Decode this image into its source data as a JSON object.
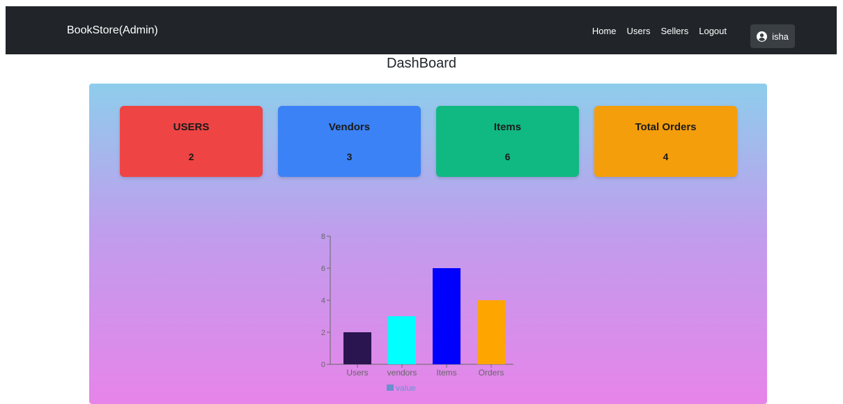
{
  "nav": {
    "brand": "BookStore(Admin)",
    "links": [
      "Home",
      "Users",
      "Sellers",
      "Logout"
    ],
    "user": {
      "name": "isha",
      "icon": "user-circle-icon"
    }
  },
  "page": {
    "title": "DashBoard"
  },
  "cards": [
    {
      "title": "USERS",
      "value": "2",
      "color": "#ef4444"
    },
    {
      "title": "Vendors",
      "value": "3",
      "color": "#3b82f6"
    },
    {
      "title": "Items",
      "value": "6",
      "color": "#10b981"
    },
    {
      "title": "Total Orders",
      "value": "4",
      "color": "#f59e0b"
    }
  ],
  "chart_data": {
    "type": "bar",
    "categories": [
      "Users",
      "vendors",
      "Items",
      "Orders"
    ],
    "values": [
      2,
      3,
      6,
      4
    ],
    "colors": [
      "#2a1550",
      "#00ffff",
      "#0000ff",
      "#ffa500"
    ],
    "ylim": [
      0,
      8
    ],
    "yticks": [
      0,
      2,
      4,
      6,
      8
    ],
    "legend": {
      "label": "value",
      "color": "#6a8fd0",
      "position": "bottom"
    },
    "grid": false
  }
}
